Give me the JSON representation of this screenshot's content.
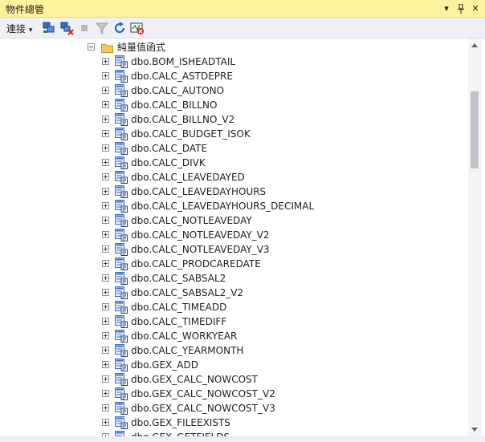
{
  "window": {
    "title": "物件總管",
    "dropdown_glyph": "▾",
    "pin_glyph": "📌",
    "close_glyph": "✕"
  },
  "toolbar": {
    "connect_label": "連接",
    "connect_caret": "▾",
    "buttons": [
      "connect-object-explorer-icon",
      "disconnect-icon",
      "stop-icon",
      "filter-icon",
      "refresh-icon",
      "activity-monitor-icon"
    ]
  },
  "tree": {
    "folder_label": "純量值函式",
    "items": [
      "dbo.BOM_ISHEADTAIL",
      "dbo.CALC_ASTDEPRE",
      "dbo.CALC_AUTONO",
      "dbo.CALC_BILLNO",
      "dbo.CALC_BILLNO_V2",
      "dbo.CALC_BUDGET_ISOK",
      "dbo.CALC_DATE",
      "dbo.CALC_DIVK",
      "dbo.CALC_LEAVEDAYED",
      "dbo.CALC_LEAVEDAYHOURS",
      "dbo.CALC_LEAVEDAYHOURS_DECIMAL",
      "dbo.CALC_NOTLEAVEDAY",
      "dbo.CALC_NOTLEAVEDAY_V2",
      "dbo.CALC_NOTLEAVEDAY_V3",
      "dbo.CALC_PRODCAREDATE",
      "dbo.CALC_SABSAL2",
      "dbo.CALC_SABSAL2_V2",
      "dbo.CALC_TIMEADD",
      "dbo.CALC_TIMEDIFF",
      "dbo.CALC_WORKYEAR",
      "dbo.CALC_YEARMONTH",
      "dbo.GEX_ADD",
      "dbo.GEX_CALC_NOWCOST",
      "dbo.GEX_CALC_NOWCOST_V2",
      "dbo.GEX_CALC_NOWCOST_V3",
      "dbo.GEX_FILEEXISTS",
      "dbo.GEX_GETFIELDS"
    ]
  },
  "colors": {
    "title_bar": "#fff29d",
    "toolbar": "#eef0f6",
    "folder": "#e8b84a",
    "scroll_thumb": "#c2c3c9"
  }
}
